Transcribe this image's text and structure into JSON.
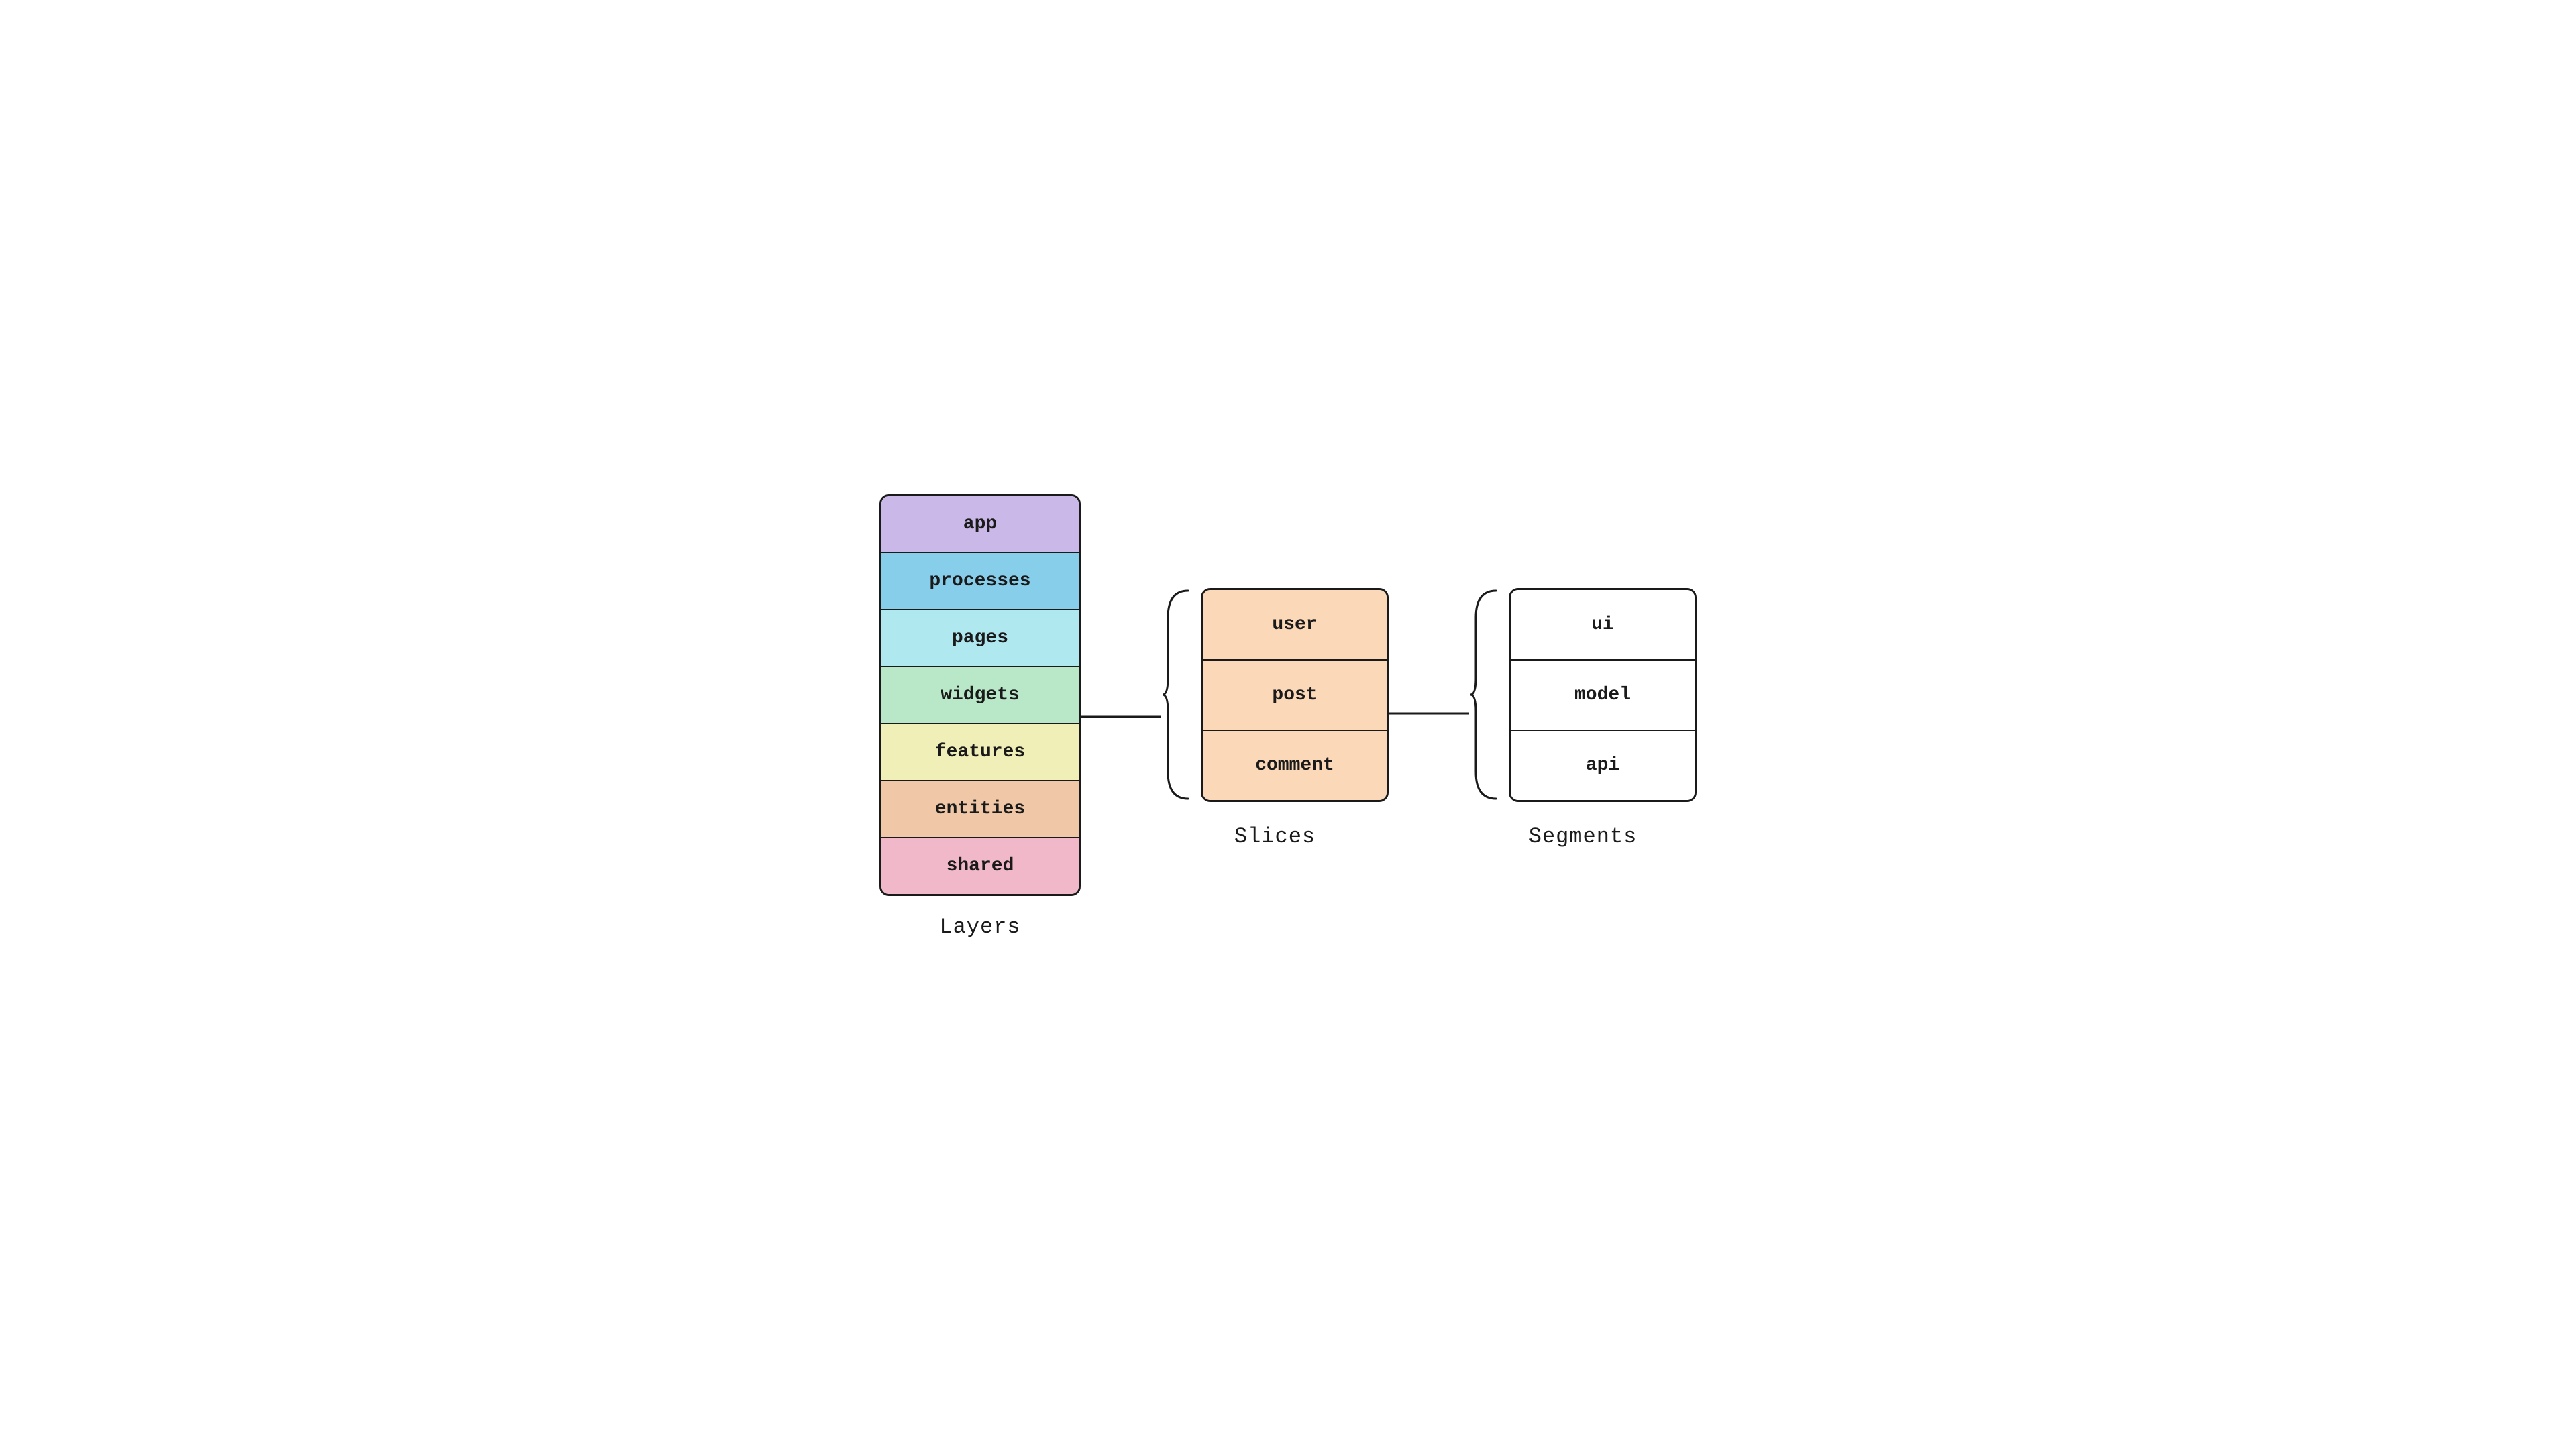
{
  "diagram": {
    "layers": {
      "label": "Layers",
      "items": [
        {
          "id": "app",
          "text": "app",
          "colorClass": "layer-app"
        },
        {
          "id": "processes",
          "text": "processes",
          "colorClass": "layer-processes"
        },
        {
          "id": "pages",
          "text": "pages",
          "colorClass": "layer-pages"
        },
        {
          "id": "widgets",
          "text": "widgets",
          "colorClass": "layer-widgets"
        },
        {
          "id": "features",
          "text": "features",
          "colorClass": "layer-features"
        },
        {
          "id": "entities",
          "text": "entities",
          "colorClass": "layer-entities"
        },
        {
          "id": "shared",
          "text": "shared",
          "colorClass": "layer-shared"
        }
      ]
    },
    "slices": {
      "label": "Slices",
      "items": [
        {
          "id": "user",
          "text": "user"
        },
        {
          "id": "post",
          "text": "post"
        },
        {
          "id": "comment",
          "text": "comment"
        }
      ]
    },
    "segments": {
      "label": "Segments",
      "items": [
        {
          "id": "ui",
          "text": "ui"
        },
        {
          "id": "model",
          "text": "model"
        },
        {
          "id": "api",
          "text": "api"
        }
      ]
    }
  }
}
